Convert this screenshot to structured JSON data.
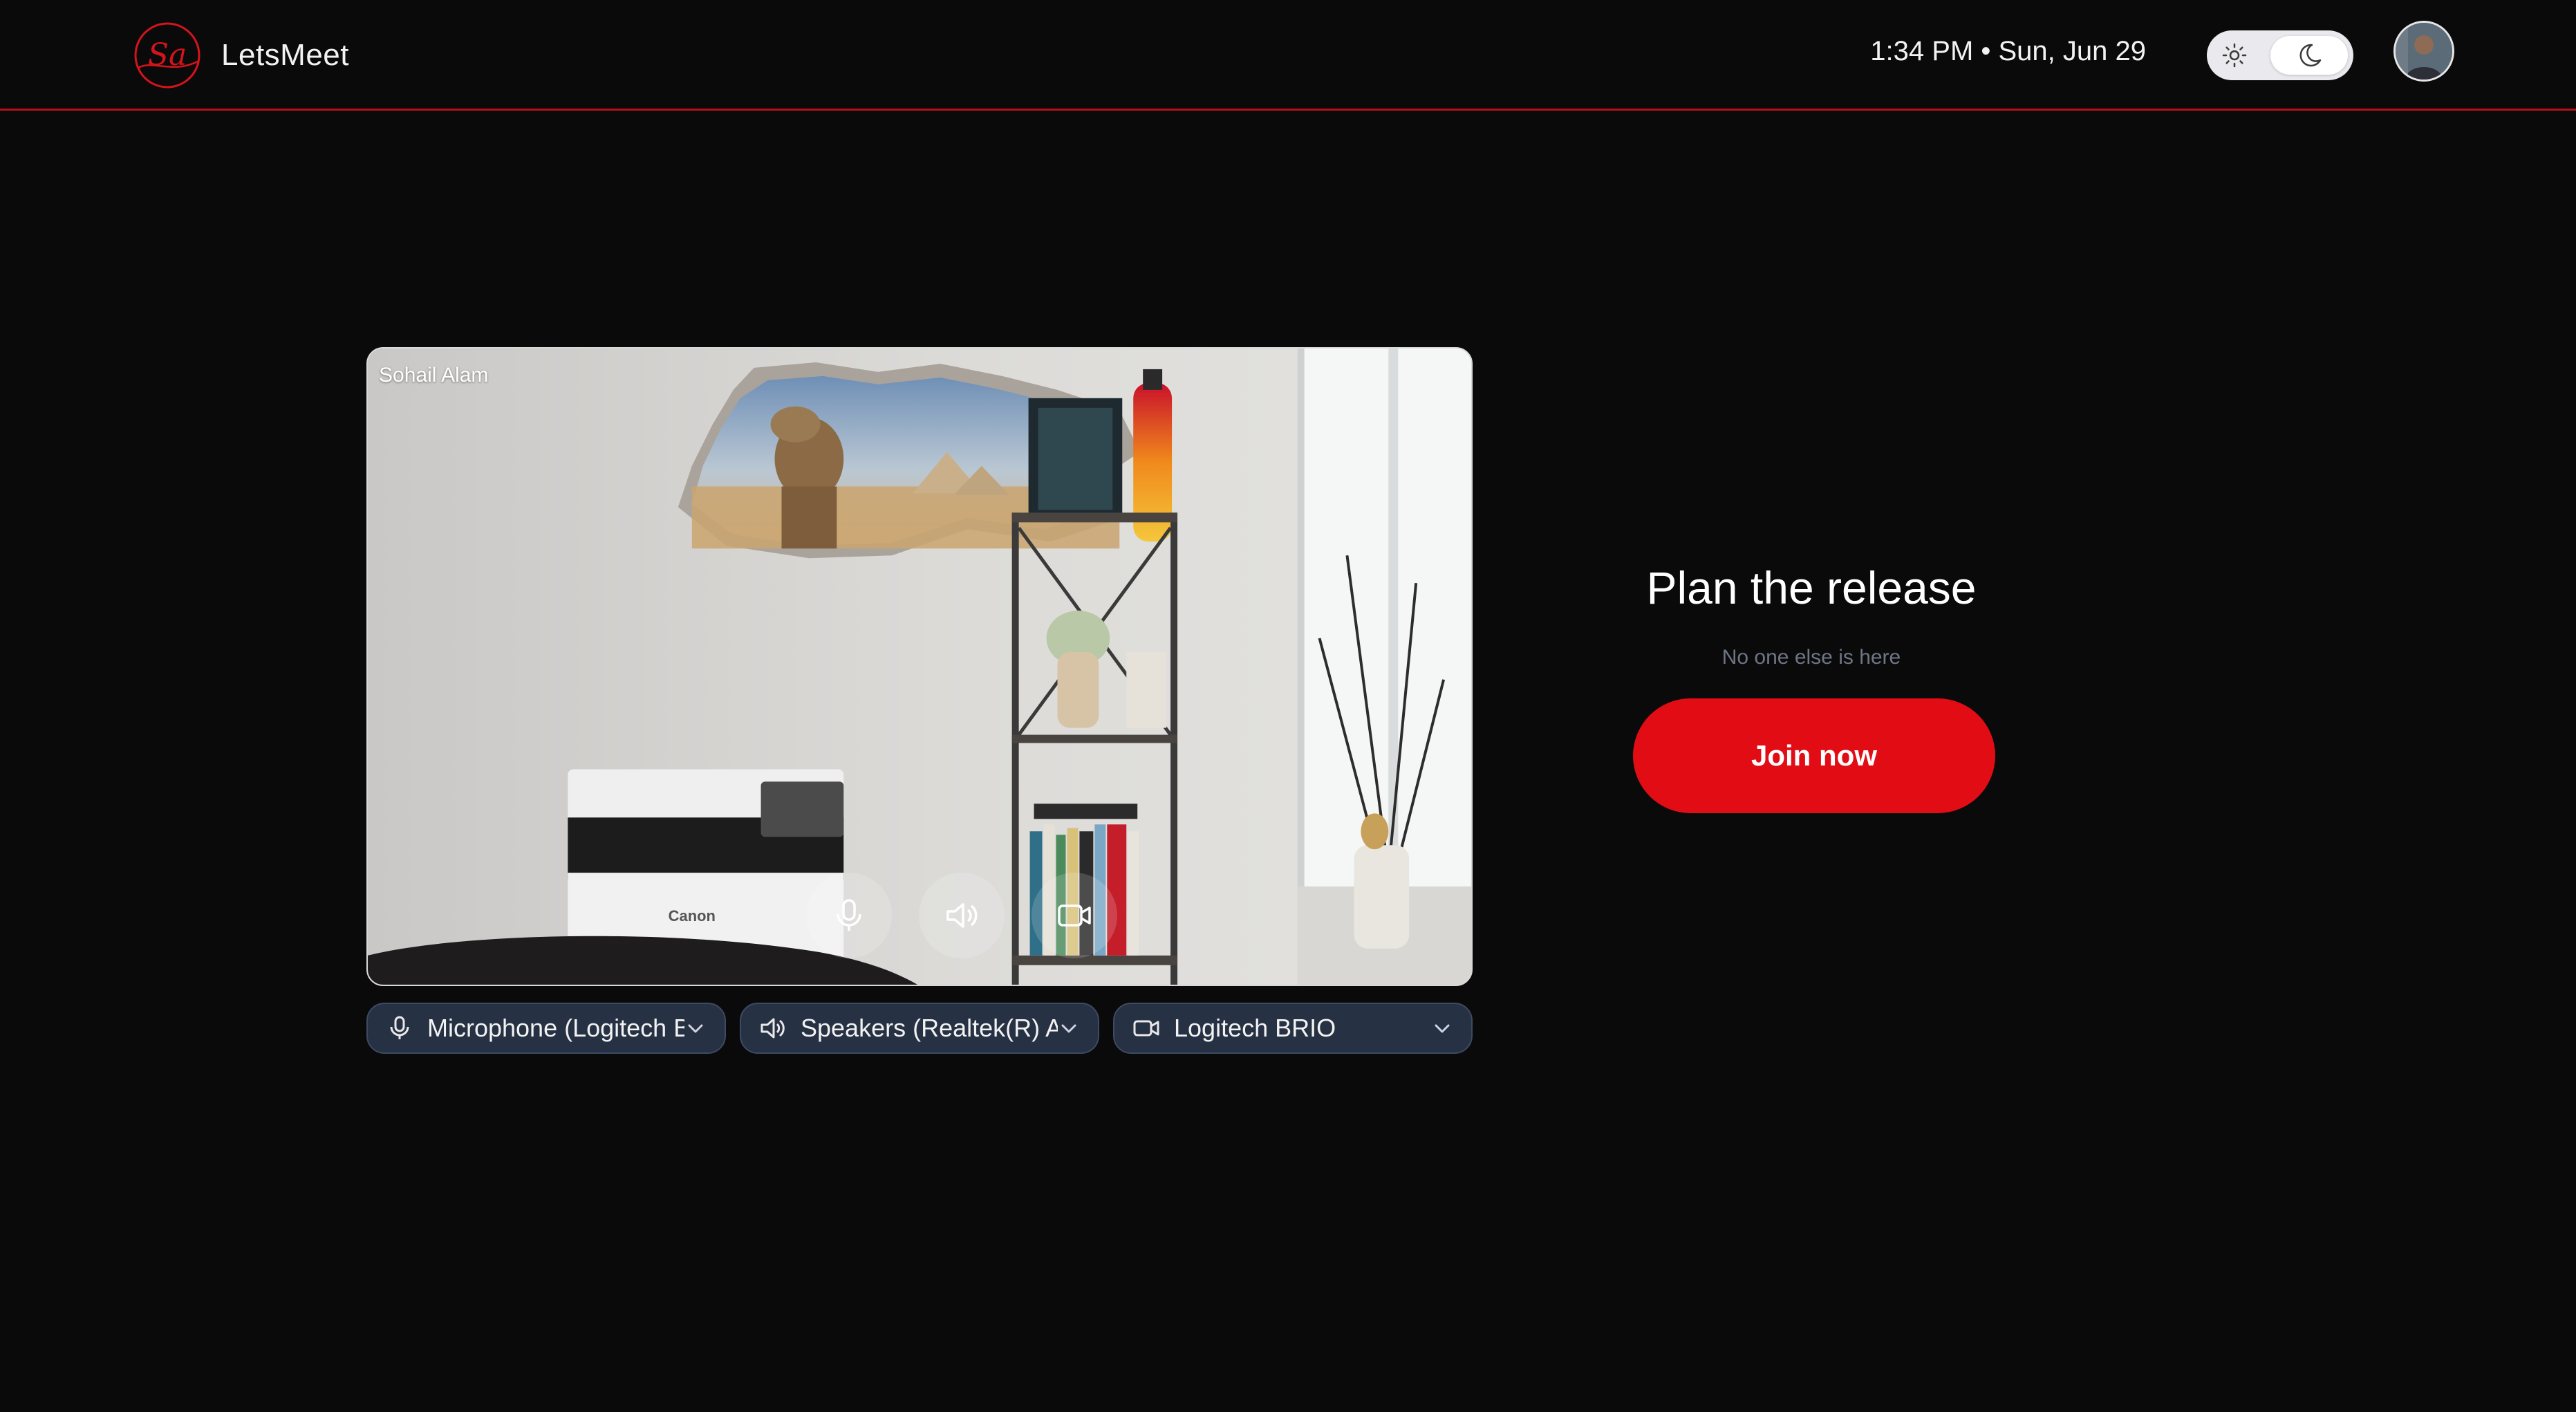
{
  "app": {
    "name": "LetsMeet",
    "logo_text": "Sa",
    "accent_color": "#e20d14"
  },
  "header": {
    "datetime": "1:34 PM • Sun, Jun 29",
    "theme_toggle": {
      "mode": "dark",
      "light_icon": "sun-icon",
      "dark_icon": "moon-icon"
    },
    "avatar_icon": "avatar"
  },
  "preview": {
    "participant_name": "Sohail Alam",
    "controls": [
      {
        "name": "microphone",
        "icon": "microphone-icon"
      },
      {
        "name": "speaker",
        "icon": "speaker-icon"
      },
      {
        "name": "camera",
        "icon": "camera-icon"
      }
    ],
    "printer_brand": "Canon"
  },
  "devices": {
    "microphone": "Microphone (Logitech B",
    "speaker": "Speakers (Realtek(R) Au",
    "camera": "Logitech BRIO"
  },
  "meeting": {
    "title": "Plan the release",
    "status": "No one else is here",
    "join_label": "Join now"
  }
}
